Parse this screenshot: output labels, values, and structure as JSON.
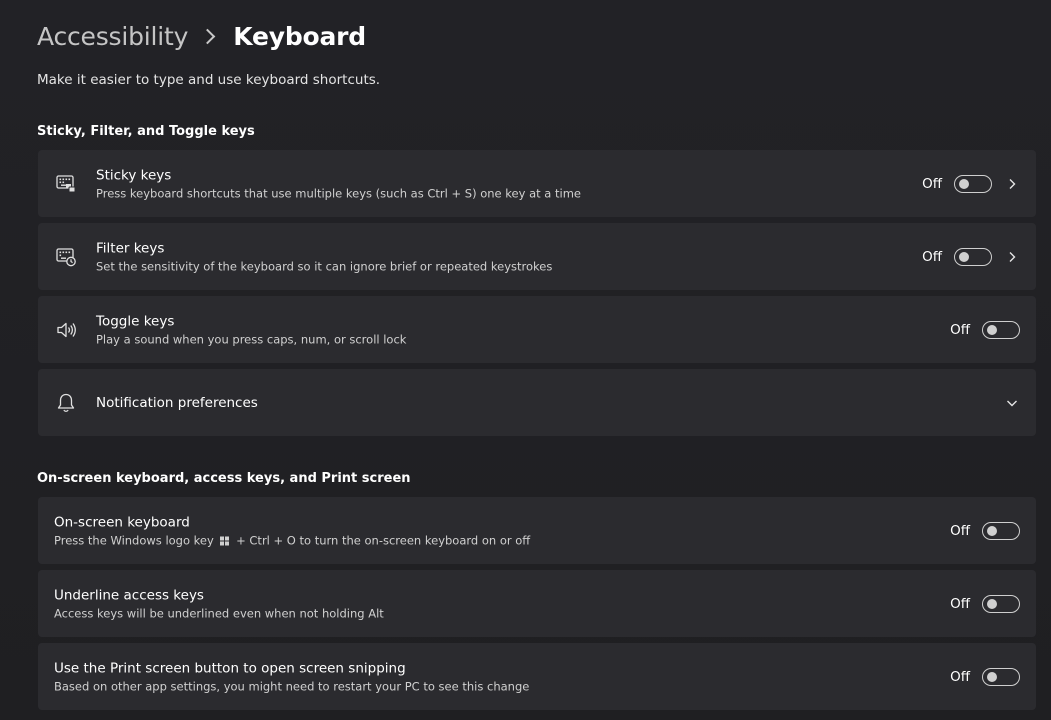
{
  "breadcrumb": {
    "parent": "Accessibility",
    "current": "Keyboard"
  },
  "subtitle": "Make it easier to type and use keyboard shortcuts.",
  "sections": {
    "sticky_filter_toggle": {
      "title": "Sticky, Filter, and Toggle keys",
      "sticky_keys": {
        "title": "Sticky keys",
        "description": "Press keyboard shortcuts that use multiple keys (such as Ctrl + S) one key at a time",
        "status": "Off",
        "icon": "sticky-keys-icon"
      },
      "filter_keys": {
        "title": "Filter keys",
        "description": "Set the sensitivity of the keyboard so it can ignore brief or repeated keystrokes",
        "status": "Off",
        "icon": "filter-keys-icon"
      },
      "toggle_keys": {
        "title": "Toggle keys",
        "description": "Play a sound when you press caps, num, or scroll lock",
        "status": "Off",
        "icon": "speaker-icon"
      },
      "notification_preferences": {
        "title": "Notification preferences",
        "icon": "bell-icon"
      }
    },
    "onscreen_access_print": {
      "title": "On-screen keyboard, access keys, and Print screen",
      "onscreen_keyboard": {
        "title": "On-screen keyboard",
        "description_before": "Press the Windows logo key",
        "description_after": "+ Ctrl + O to turn the on-screen keyboard on or off",
        "status": "Off"
      },
      "underline_access_keys": {
        "title": "Underline access keys",
        "description": "Access keys will be underlined even when not holding Alt",
        "status": "Off"
      },
      "print_screen": {
        "title": "Use the Print screen button to open screen snipping",
        "description": "Based on other app settings, you might need to restart your PC to see this change",
        "status": "Off"
      }
    }
  }
}
